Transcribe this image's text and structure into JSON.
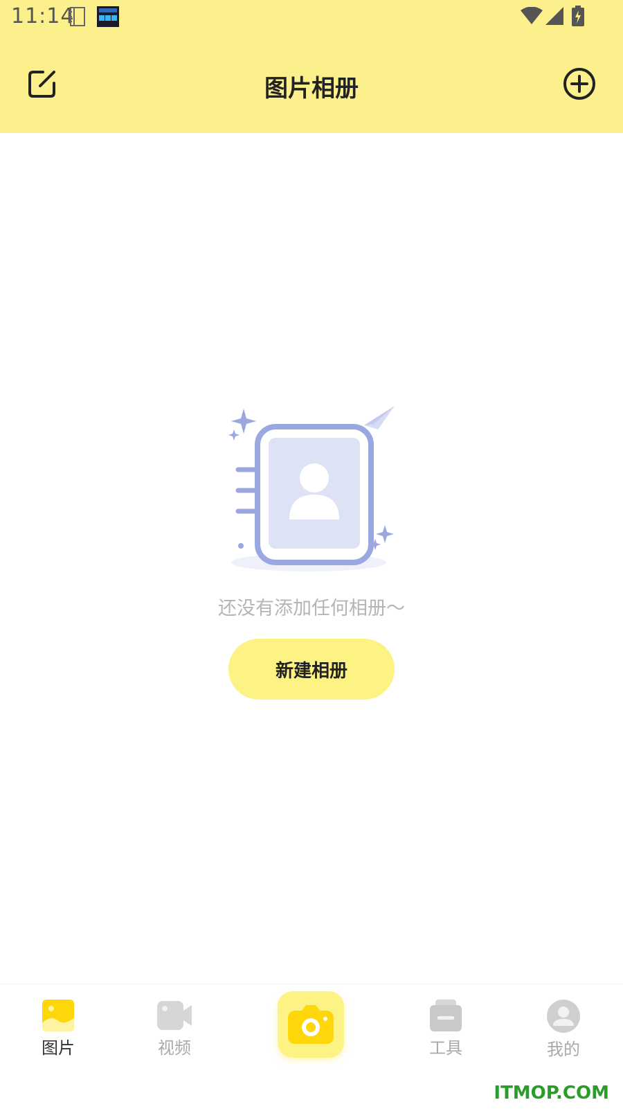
{
  "status_bar": {
    "time": "11:14"
  },
  "header": {
    "title": "图片相册"
  },
  "empty_state": {
    "message": "还没有添加任何相册～",
    "button_label": "新建相册"
  },
  "bottom_nav": {
    "items": [
      {
        "label": "图片",
        "icon": "image-icon",
        "active": true
      },
      {
        "label": "视频",
        "icon": "video-icon",
        "active": false
      },
      {
        "label": "",
        "icon": "camera-icon",
        "active": false
      },
      {
        "label": "工具",
        "icon": "toolbox-icon",
        "active": false
      },
      {
        "label": "我的",
        "icon": "profile-icon",
        "active": false
      }
    ]
  },
  "watermark": "ITMOP.COM",
  "colors": {
    "header_bg": "#fcf08c",
    "accent_yellow": "#fdf384",
    "icon_active": "#ffd60a",
    "illustration_blue": "#9aa7e0",
    "watermark_green": "#2a9c2a"
  }
}
